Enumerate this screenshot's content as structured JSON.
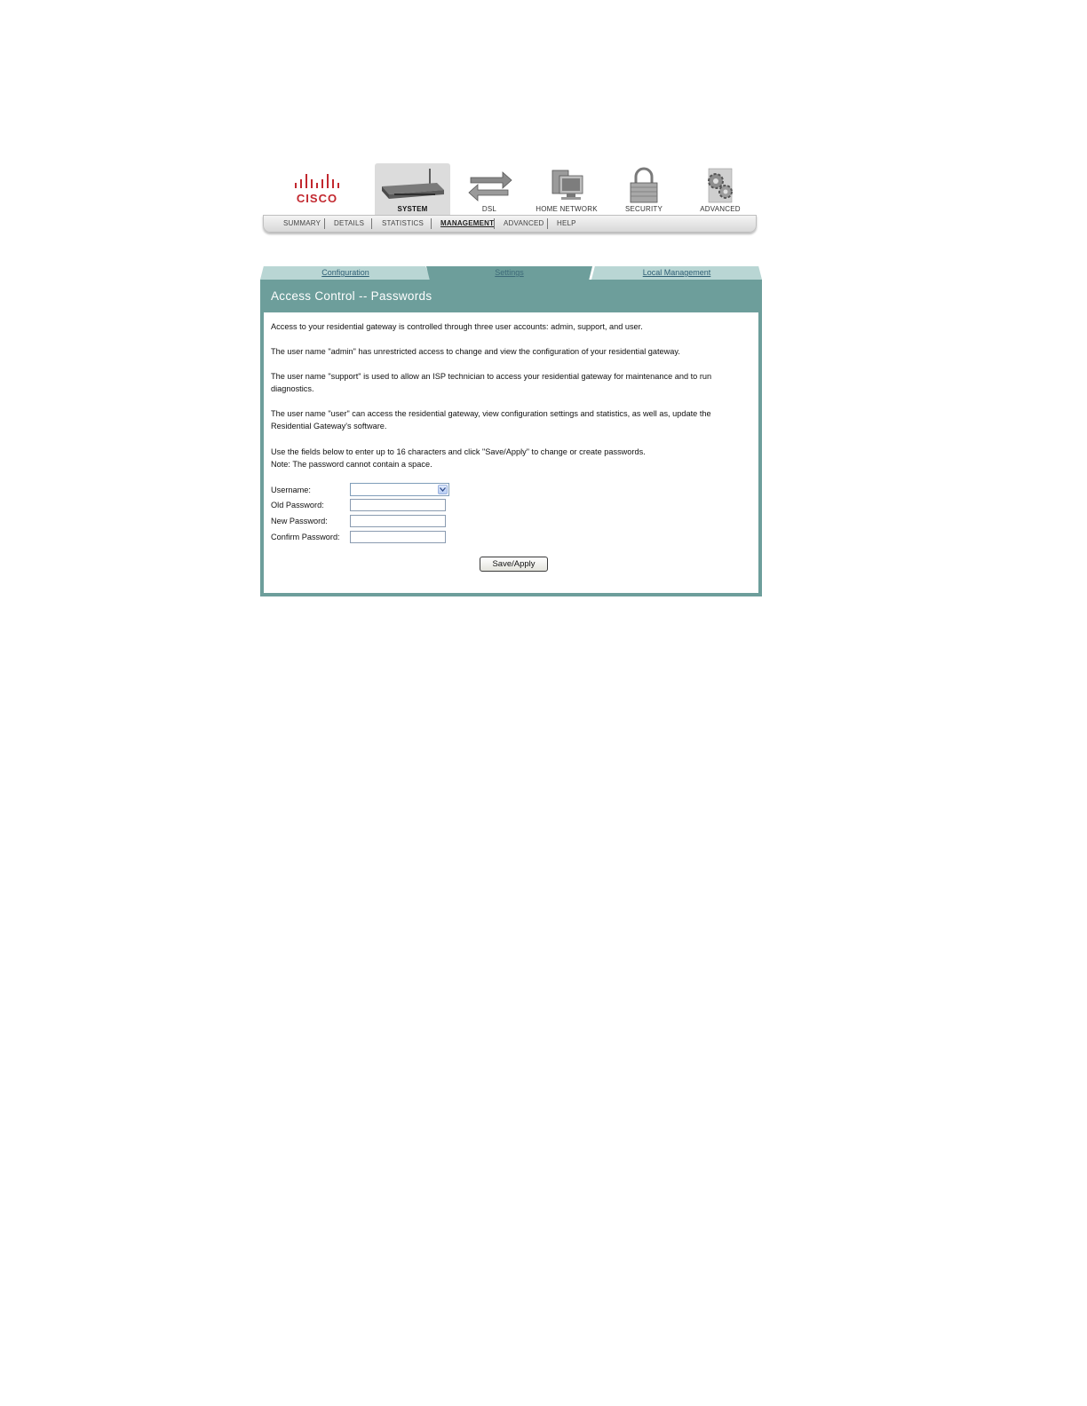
{
  "brand": {
    "logo_text": "CISCO"
  },
  "top_nav": [
    {
      "label": "SYSTEM",
      "icon": "router-icon",
      "active": true
    },
    {
      "label": "DSL",
      "icon": "transfer-arrows-icon",
      "active": false
    },
    {
      "label": "HOME NETWORK",
      "icon": "computers-icon",
      "active": false
    },
    {
      "label": "SECURITY",
      "icon": "padlock-icon",
      "active": false
    },
    {
      "label": "ADVANCED",
      "icon": "gears-icon",
      "active": false
    }
  ],
  "sub_nav": [
    {
      "label": "SUMMARY",
      "active": false
    },
    {
      "label": "DETAILS",
      "active": false
    },
    {
      "label": "STATISTICS",
      "active": false
    },
    {
      "label": "MANAGEMENT",
      "active": true
    },
    {
      "label": "ADVANCED",
      "active": false
    },
    {
      "label": "HELP",
      "active": false
    }
  ],
  "tabs": [
    {
      "label": "Configuration",
      "active": false
    },
    {
      "label": "Settings",
      "active": true
    },
    {
      "label": "Local Management",
      "active": false
    }
  ],
  "panel": {
    "title": "Access Control -- Passwords",
    "paragraphs": [
      "Access to your residential gateway is controlled through three user accounts: admin, support, and user.",
      "The user name \"admin\" has unrestricted access to change and view the configuration of your residential gateway.",
      "The user name \"support\" is used to allow an ISP technician to access your residential gateway for maintenance and to run diagnostics.",
      "The user name \"user\" can access the residential gateway, view configuration settings and statistics, as well as, update the Residential Gateway's software.",
      "Use the fields below to enter up to 16 characters and click \"Save/Apply\" to change or create passwords.",
      "Note: The password cannot contain a space."
    ]
  },
  "form": {
    "username_label": "Username:",
    "username_value": "",
    "old_password_label": "Old Password:",
    "old_password_value": "",
    "new_password_label": "New Password:",
    "new_password_value": "",
    "confirm_password_label": "Confirm Password:",
    "confirm_password_value": "",
    "submit_label": "Save/Apply"
  },
  "colors": {
    "brand_red": "#c2282f",
    "panel_teal": "#6d9e9b",
    "tab_light": "#b9d6d4"
  }
}
